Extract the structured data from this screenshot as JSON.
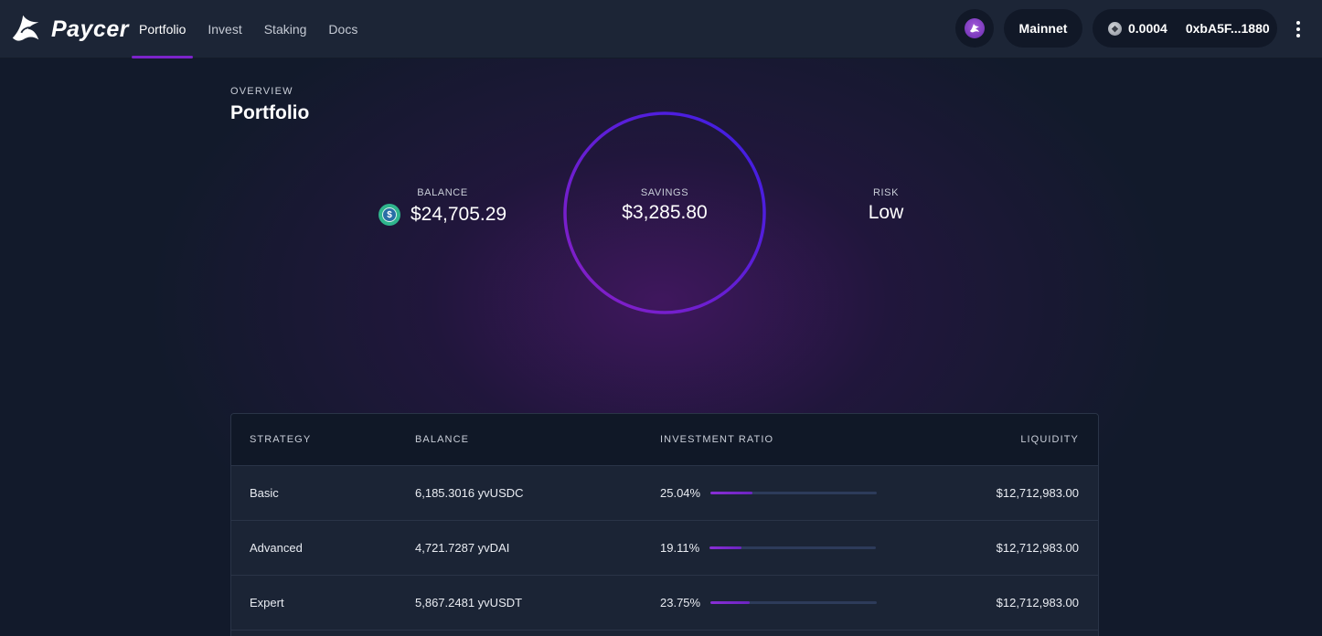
{
  "brand": {
    "name": "Paycer"
  },
  "nav": [
    {
      "label": "Portfolio",
      "active": true
    },
    {
      "label": "Invest",
      "active": false
    },
    {
      "label": "Staking",
      "active": false
    },
    {
      "label": "Docs",
      "active": false
    }
  ],
  "header": {
    "network_icon": "network-logo-icon",
    "network_label": "Mainnet",
    "wallet_balance": "0.0004",
    "wallet_address": "0xbA5F...1880",
    "more_icon": "more-vertical-icon"
  },
  "overview": {
    "overline": "OVERVIEW",
    "title": "Portfolio"
  },
  "stats": {
    "balance": {
      "label": "BALANCE",
      "value": "$24,705.29",
      "icon": "usdc-coin-icon"
    },
    "savings": {
      "label": "SAVINGS",
      "value": "$3,285.80",
      "ring_fraction": 1.0
    },
    "risk": {
      "label": "RISK",
      "value": "Low"
    }
  },
  "table": {
    "headers": [
      "STRATEGY",
      "BALANCE",
      "INVESTMENT RATIO",
      "LIQUIDITY"
    ],
    "rows": [
      {
        "strategy": "Basic",
        "balance": "6,185.3016 yvUSDC",
        "ratio_text": "25.04%",
        "ratio": 25.04,
        "liquidity": "$12,712,983.00"
      },
      {
        "strategy": "Advanced",
        "balance": "4,721.7287 yvDAI",
        "ratio_text": "19.11%",
        "ratio": 19.11,
        "liquidity": "$12,712,983.00"
      },
      {
        "strategy": "Expert",
        "balance": "5,867.2481 yvUSDT",
        "ratio_text": "23.75%",
        "ratio": 23.75,
        "liquidity": "$12,712,983.00"
      }
    ]
  },
  "colors": {
    "accent": "#7b23c9",
    "ring_start": "#8a1fc4",
    "ring_end": "#3b1ee6"
  }
}
